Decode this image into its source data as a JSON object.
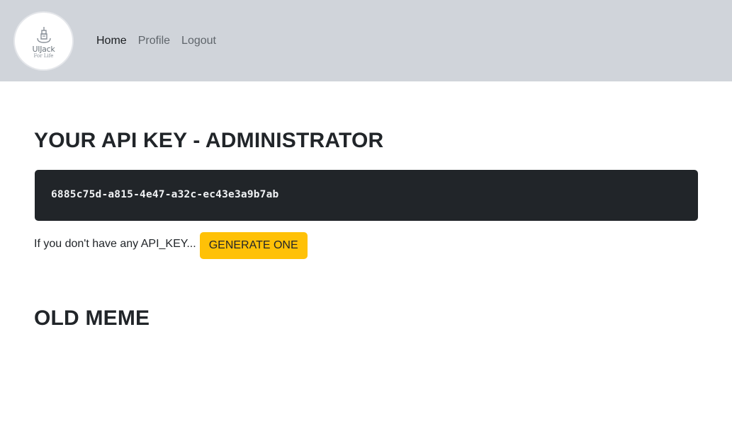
{
  "brand": {
    "logo_text": "UIJack",
    "logo_subtext": "For Life",
    "icon": "jack-logo-icon"
  },
  "nav": {
    "home": "Home",
    "profile": "Profile",
    "logout": "Logout"
  },
  "api_section": {
    "title": "YOUR API KEY - ADMINISTRATOR",
    "api_key": "6885c75d-a815-4e47-a32c-ec43e3a9b7ab",
    "prompt": "If you don't have any API_KEY...",
    "generate_label": "GENERATE ONE"
  },
  "meme_section": {
    "title": "OLD MEME"
  },
  "colors": {
    "navbar_bg": "#d0d4da",
    "key_bg": "#212529",
    "button_bg": "#ffc107"
  }
}
